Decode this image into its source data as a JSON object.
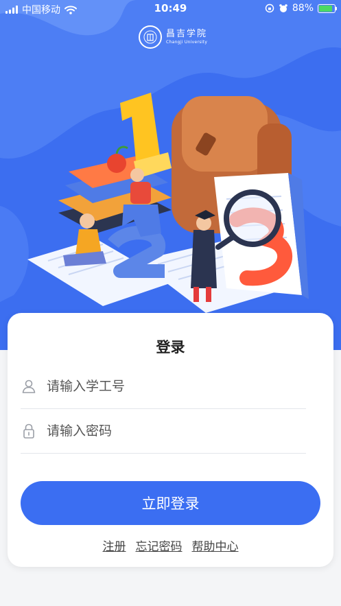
{
  "status_bar": {
    "carrier": "中国移动",
    "time": "10:49",
    "battery": "88%",
    "battery_level": 0.88
  },
  "header": {
    "school_name_cn": "昌吉学院",
    "school_name_en": "Changji University"
  },
  "login": {
    "title": "登录",
    "student_id_placeholder": "请输入学工号",
    "password_placeholder": "请输入密码",
    "submit_label": "立即登录",
    "links": {
      "register": "注册",
      "forgot_password": "忘记密码",
      "help_center": "帮助中心"
    }
  },
  "colors": {
    "primary": "#3B6EF2",
    "hero_background": "#3C6EF0",
    "page_background": "#F4F5F7",
    "battery_fill": "#4CD964"
  },
  "icons": [
    "signal-icon",
    "wifi-icon",
    "rotation-lock-icon",
    "alarm-icon",
    "battery-icon",
    "school-seal-logo",
    "user-icon",
    "lock-icon"
  ]
}
